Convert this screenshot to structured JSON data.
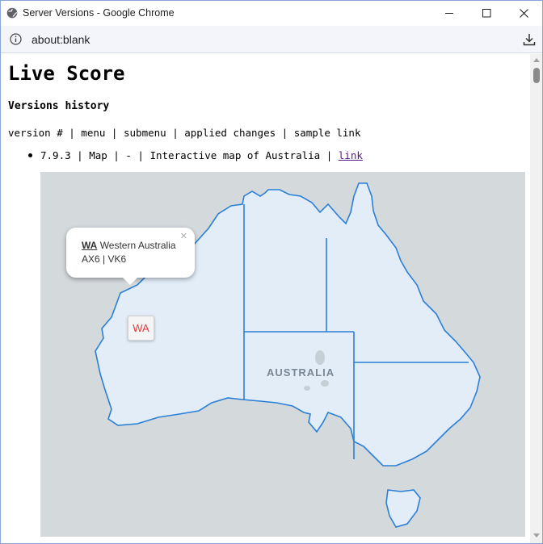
{
  "window": {
    "title": "Server Versions - Google Chrome"
  },
  "address_bar": {
    "url": "about:blank"
  },
  "page": {
    "heading": "Live Score",
    "subheading": "Versions history",
    "columns_line": "version # | menu | submenu | applied changes | sample link",
    "versions": [
      {
        "text": "7.9.3 | Map | - | Interactive map of Australia | ",
        "link_label": "link"
      }
    ]
  },
  "map": {
    "country_label": "AUSTRALIA",
    "popup": {
      "code": "WA",
      "name": "Western Australia",
      "callsigns": "AX6 | VK6",
      "close_symbol": "×"
    },
    "marker_label": "WA",
    "colors": {
      "land": "#e2edf8",
      "border": "#2b7fd6",
      "sea": "#d4d9dc",
      "marker_text": "#e03a3a"
    }
  },
  "icons": [
    "globe-icon",
    "minimize-icon",
    "maximize-icon",
    "close-icon",
    "info-icon",
    "download-icon"
  ]
}
